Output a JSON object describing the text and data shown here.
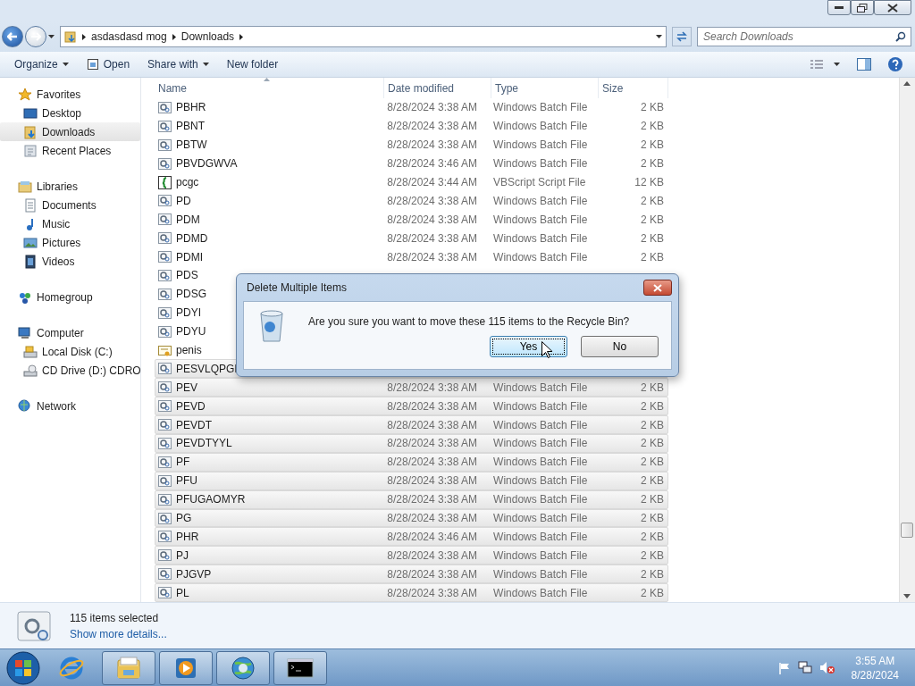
{
  "address_bar": {
    "crumbs": [
      "asdasdasd mog",
      "Downloads"
    ]
  },
  "search": {
    "placeholder": "Search Downloads"
  },
  "toolbar": {
    "items": [
      {
        "label": "Organize",
        "kind": "menu"
      },
      {
        "label": "Open",
        "kind": "open"
      },
      {
        "label": "Share with",
        "kind": "menu"
      },
      {
        "label": "New folder",
        "kind": "plain"
      }
    ]
  },
  "sidebar": {
    "groups": [
      {
        "label": "Favorites",
        "kind": "star",
        "selected": false,
        "children": [
          {
            "label": "Desktop",
            "kind": "desktop",
            "selected": false
          },
          {
            "label": "Downloads",
            "kind": "downloads",
            "selected": true
          },
          {
            "label": "Recent Places",
            "kind": "recent",
            "selected": false
          }
        ]
      },
      {
        "label": "Libraries",
        "kind": "libraries",
        "selected": false,
        "children": [
          {
            "label": "Documents",
            "kind": "document",
            "selected": false
          },
          {
            "label": "Music",
            "kind": "music",
            "selected": false
          },
          {
            "label": "Pictures",
            "kind": "pictures",
            "selected": false
          },
          {
            "label": "Videos",
            "kind": "videos",
            "selected": false
          }
        ]
      },
      {
        "label": "Homegroup",
        "kind": "homegroup",
        "selected": false
      },
      {
        "label": "Computer",
        "kind": "computer",
        "selected": false,
        "children": [
          {
            "label": "Local Disk (C:)",
            "kind": "disk",
            "selected": false
          },
          {
            "label": "CD Drive (D:) CDRO",
            "kind": "cd",
            "selected": false
          }
        ]
      },
      {
        "label": "Network",
        "kind": "network",
        "selected": false
      }
    ]
  },
  "table": {
    "columns": [
      "Name",
      "Date modified",
      "Type",
      "Size"
    ],
    "rows": [
      {
        "name": "PBHR",
        "kind": "batch",
        "selected": false,
        "date": "8/28/2024 3:38 AM",
        "type": "Windows Batch File",
        "size": "2 KB"
      },
      {
        "name": "PBNT",
        "kind": "batch",
        "selected": false,
        "date": "8/28/2024 3:38 AM",
        "type": "Windows Batch File",
        "size": "2 KB"
      },
      {
        "name": "PBTW",
        "kind": "batch",
        "selected": false,
        "date": "8/28/2024 3:38 AM",
        "type": "Windows Batch File",
        "size": "2 KB"
      },
      {
        "name": "PBVDGWVA",
        "kind": "batch",
        "selected": false,
        "date": "8/28/2024 3:46 AM",
        "type": "Windows Batch File",
        "size": "2 KB"
      },
      {
        "name": "pcgc",
        "kind": "vbscript",
        "selected": false,
        "date": "8/28/2024 3:44 AM",
        "type": "VBScript Script File",
        "size": "12 KB"
      },
      {
        "name": "PD",
        "kind": "batch",
        "selected": false,
        "date": "8/28/2024 3:38 AM",
        "type": "Windows Batch File",
        "size": "2 KB"
      },
      {
        "name": "PDM",
        "kind": "batch",
        "selected": false,
        "date": "8/28/2024 3:38 AM",
        "type": "Windows Batch File",
        "size": "2 KB"
      },
      {
        "name": "PDMD",
        "kind": "batch",
        "selected": false,
        "date": "8/28/2024 3:38 AM",
        "type": "Windows Batch File",
        "size": "2 KB"
      },
      {
        "name": "PDMI",
        "kind": "batch",
        "selected": false,
        "date": "8/28/2024 3:38 AM",
        "type": "Windows Batch File",
        "size": "2 KB"
      },
      {
        "name": "PDS",
        "kind": "batch",
        "selected": false
      },
      {
        "name": "PDSG",
        "kind": "batch",
        "selected": false
      },
      {
        "name": "PDYI",
        "kind": "batch",
        "selected": false
      },
      {
        "name": "PDYU",
        "kind": "batch",
        "selected": false
      },
      {
        "name": "penis",
        "kind": "certificate",
        "selected": false
      },
      {
        "name": "PESVLQPGI",
        "kind": "batch",
        "selected": true
      },
      {
        "name": "PEV",
        "kind": "batch",
        "selected": true,
        "date": "8/28/2024 3:38 AM",
        "type": "Windows Batch File",
        "size": "2 KB"
      },
      {
        "name": "PEVD",
        "kind": "batch",
        "selected": true,
        "date": "8/28/2024 3:38 AM",
        "type": "Windows Batch File",
        "size": "2 KB"
      },
      {
        "name": "PEVDT",
        "kind": "batch",
        "selected": true,
        "date": "8/28/2024 3:38 AM",
        "type": "Windows Batch File",
        "size": "2 KB"
      },
      {
        "name": "PEVDTYYL",
        "kind": "batch",
        "selected": true,
        "date": "8/28/2024 3:38 AM",
        "type": "Windows Batch File",
        "size": "2 KB"
      },
      {
        "name": "PF",
        "kind": "batch",
        "selected": true,
        "date": "8/28/2024 3:38 AM",
        "type": "Windows Batch File",
        "size": "2 KB"
      },
      {
        "name": "PFU",
        "kind": "batch",
        "selected": true,
        "date": "8/28/2024 3:38 AM",
        "type": "Windows Batch File",
        "size": "2 KB"
      },
      {
        "name": "PFUGAOMYR",
        "kind": "batch",
        "selected": true,
        "date": "8/28/2024 3:38 AM",
        "type": "Windows Batch File",
        "size": "2 KB"
      },
      {
        "name": "PG",
        "kind": "batch",
        "selected": true,
        "date": "8/28/2024 3:38 AM",
        "type": "Windows Batch File",
        "size": "2 KB"
      },
      {
        "name": "PHR",
        "kind": "batch",
        "selected": true,
        "date": "8/28/2024 3:46 AM",
        "type": "Windows Batch File",
        "size": "2 KB"
      },
      {
        "name": "PJ",
        "kind": "batch",
        "selected": true,
        "date": "8/28/2024 3:38 AM",
        "type": "Windows Batch File",
        "size": "2 KB"
      },
      {
        "name": "PJGVP",
        "kind": "batch",
        "selected": true,
        "date": "8/28/2024 3:38 AM",
        "type": "Windows Batch File",
        "size": "2 KB"
      },
      {
        "name": "PL",
        "kind": "batch",
        "selected": true,
        "date": "8/28/2024 3:38 AM",
        "type": "Windows Batch File",
        "size": "2 KB"
      }
    ]
  },
  "status_bar": {
    "summary": "115 items selected",
    "details_link": "Show more details..."
  },
  "dialog": {
    "title": "Delete Multiple Items",
    "message": "Are you sure you want to move these 115 items to the Recycle Bin?",
    "buttons": [
      {
        "label": "Yes",
        "selected": true
      },
      {
        "label": "No",
        "selected": false
      }
    ]
  },
  "taskbar": {
    "apps": [
      {
        "kind": "ie",
        "open": false
      },
      {
        "kind": "explorer",
        "open": true
      },
      {
        "kind": "media",
        "open": true
      },
      {
        "kind": "globe",
        "open": true
      },
      {
        "kind": "console",
        "open": true
      }
    ],
    "time": "3:55 AM",
    "date": "8/28/2024"
  }
}
